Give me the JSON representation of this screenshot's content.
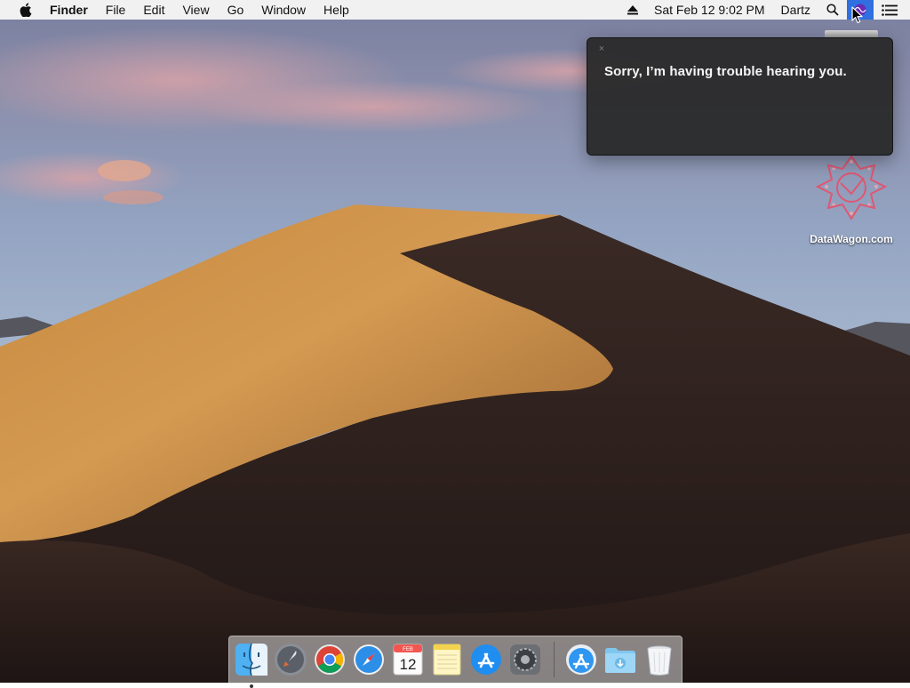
{
  "menubar": {
    "app_name": "Finder",
    "menus": [
      "File",
      "Edit",
      "View",
      "Go",
      "Window",
      "Help"
    ],
    "clock": "Sat Feb 12  9:02 PM",
    "user": "Dartz"
  },
  "siri": {
    "close_glyph": "×",
    "message": "Sorry, I’m having trouble hearing you."
  },
  "desktop_icon": {
    "label": "DataWagon.com"
  },
  "dock": {
    "items": [
      "finder-icon",
      "launchpad-icon",
      "chrome-icon",
      "safari-icon",
      "calendar-icon",
      "notes-icon",
      "app-store-icon",
      "system-preferences-icon",
      "app-store-icon",
      "downloads-folder-icon",
      "trash-icon"
    ],
    "calendar": {
      "month": "FEB",
      "day": "12"
    }
  },
  "colors": {
    "menubar_bg": "#f6f6f6",
    "siri_highlight": "#2f6fe0",
    "panel_bg": "#282828"
  }
}
